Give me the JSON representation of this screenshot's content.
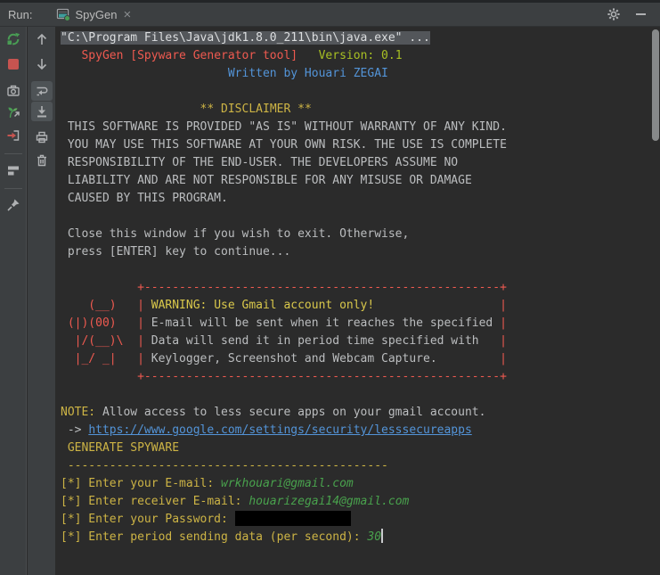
{
  "colors": {
    "panel_bg": "#3C3F41",
    "console_bg": "#2B2B2B",
    "error_red": "#EF5A50",
    "ansi_green": "#A8C023",
    "ansi_blue": "#5394D8",
    "ansi_yellow": "#CDB445",
    "user_input_green": "#49A24D",
    "selection_gray": "#53565A",
    "stop_red": "#C75450",
    "run_green": "#499C54"
  },
  "titlebar": {
    "run_label": "Run:",
    "tab_label": "SpyGen",
    "close_glyph": "×"
  },
  "icons": {
    "tab": "run-console-window",
    "header": [
      "gear-settings",
      "minimize"
    ],
    "run_toolbar": [
      "rerun",
      "stop",
      "camera-snapshot",
      "thread-dump",
      "exit",
      "restore-layout",
      "pin-tab"
    ],
    "console_toolbar": [
      "up-stack-trace",
      "down-stack-trace",
      "soft-wrap (toggled on)",
      "scroll-to-end (toggled on)",
      "print",
      "clear-all"
    ]
  },
  "console": {
    "lines": [
      {
        "hl": true,
        "segs": [
          {
            "t": "\"C:\\Program Files\\Java\\jdk1.8.0_211\\bin\\java.exe\" ...",
            "c": "bright"
          }
        ]
      },
      {
        "segs": [
          {
            "t": "   ",
            "c": "fg"
          },
          {
            "t": "SpyGen [Spyware Generator tool]",
            "c": "red"
          },
          {
            "t": "   ",
            "c": "fg"
          },
          {
            "t": "Version: 0.1",
            "c": "green"
          }
        ]
      },
      {
        "segs": [
          {
            "t": "                        ",
            "c": "fg"
          },
          {
            "t": "Written by Houari ZEGAI",
            "c": "blue"
          }
        ]
      },
      {
        "segs": []
      },
      {
        "segs": [
          {
            "t": "                    ",
            "c": "fg"
          },
          {
            "t": "** DISCLAIMER **",
            "c": "yellow"
          }
        ]
      },
      {
        "segs": [
          {
            "t": " THIS SOFTWARE IS PROVIDED \"AS IS\" WITHOUT WARRANTY OF ANY KIND.",
            "c": "fg"
          }
        ]
      },
      {
        "segs": [
          {
            "t": " YOU MAY USE THIS SOFTWARE AT YOUR OWN RISK. THE USE IS COMPLETE",
            "c": "fg"
          }
        ]
      },
      {
        "segs": [
          {
            "t": " RESPONSIBILITY OF THE END-USER. THE DEVELOPERS ASSUME NO",
            "c": "fg"
          }
        ]
      },
      {
        "segs": [
          {
            "t": " LIABILITY AND ARE NOT RESPONSIBLE FOR ANY MISUSE OR DAMAGE",
            "c": "fg"
          }
        ]
      },
      {
        "segs": [
          {
            "t": " CAUSED BY THIS PROGRAM.",
            "c": "fg"
          }
        ]
      },
      {
        "segs": []
      },
      {
        "segs": [
          {
            "t": " Close this window if you wish to exit. Otherwise,",
            "c": "fg"
          }
        ]
      },
      {
        "segs": [
          {
            "t": " press [ENTER] key to continue...",
            "c": "fg"
          }
        ]
      },
      {
        "segs": []
      },
      {
        "segs": [
          {
            "t": "           +---------------------------------------------------+",
            "c": "red"
          }
        ]
      },
      {
        "segs": [
          {
            "t": "    (__)   |",
            "c": "red"
          },
          {
            "t": " WARNING: Use Gmail account only!",
            "c": "warn"
          },
          {
            "t": "                  ",
            "c": "fg"
          },
          {
            "t": "|",
            "c": "red"
          }
        ]
      },
      {
        "segs": [
          {
            "t": " (|)(00)   |",
            "c": "red"
          },
          {
            "t": " E-mail will be sent when it reaches the specified ",
            "c": "fg"
          },
          {
            "t": "|",
            "c": "red"
          }
        ]
      },
      {
        "segs": [
          {
            "t": "  |/(__)\\  |",
            "c": "red"
          },
          {
            "t": " Data will send it in period time specified with",
            "c": "fg"
          },
          {
            "t": "   ",
            "c": "fg"
          },
          {
            "t": "|",
            "c": "red"
          }
        ]
      },
      {
        "segs": [
          {
            "t": "  |_/ _|   |",
            "c": "red"
          },
          {
            "t": " Keylogger, Screenshot and Webcam Capture.",
            "c": "fg"
          },
          {
            "t": "         ",
            "c": "fg"
          },
          {
            "t": "|",
            "c": "red"
          }
        ]
      },
      {
        "segs": [
          {
            "t": "           +---------------------------------------------------+",
            "c": "red"
          }
        ]
      },
      {
        "segs": []
      },
      {
        "segs": [
          {
            "t": "NOTE:",
            "c": "yellow"
          },
          {
            "t": " Allow access to less secure apps on your gmail account.",
            "c": "fg"
          }
        ]
      },
      {
        "segs": [
          {
            "t": " -> ",
            "c": "fg"
          },
          {
            "t": "https://www.google.com/settings/security/lesssecureapps",
            "type": "link"
          }
        ]
      },
      {
        "segs": [
          {
            "t": " ",
            "c": "fg"
          },
          {
            "t": "GENERATE SPYWARE",
            "c": "yellow"
          }
        ]
      },
      {
        "segs": [
          {
            "t": " ",
            "c": "fg"
          },
          {
            "t": "----------------------------------------------",
            "c": "yellow"
          }
        ]
      },
      {
        "segs": [
          {
            "t": "[*] Enter your E-mail: ",
            "c": "yellow"
          },
          {
            "t": "wrkhouari@gmail.com",
            "c": "input"
          }
        ]
      },
      {
        "segs": [
          {
            "t": "[*] Enter receiver E-mail: ",
            "c": "yellow"
          },
          {
            "t": "houarizegai14@gmail.com",
            "c": "input"
          }
        ]
      },
      {
        "segs": [
          {
            "t": "[*] Enter your Password: ",
            "c": "yellow"
          },
          {
            "type": "redact"
          }
        ]
      },
      {
        "segs": [
          {
            "t": "[*] Enter period sending data (per second): ",
            "c": "yellow"
          },
          {
            "t": "30",
            "c": "input"
          },
          {
            "type": "caret"
          }
        ]
      }
    ]
  }
}
